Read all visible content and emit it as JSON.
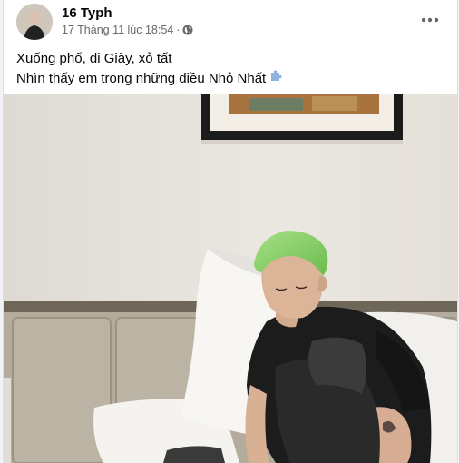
{
  "post": {
    "author": "16 Typh",
    "timestamp": "17 Tháng 11 lúc 18:54",
    "separator": "·",
    "audience_icon": "globe-icon",
    "more_icon": "more-options-icon",
    "caption_line1": "Xuống phố, đi Giày, xỏ tất",
    "caption_line2": "Nhìn thấy em trong những điều Nhỏ Nhất",
    "caption_emoji": "puzzle-piece-icon"
  },
  "colors": {
    "hair": "#8fd16f",
    "wall": "#e9e6e0",
    "headboard": "#b3ab9b",
    "pillow": "#f7f6f3",
    "shirt": "#1a1a1a"
  }
}
